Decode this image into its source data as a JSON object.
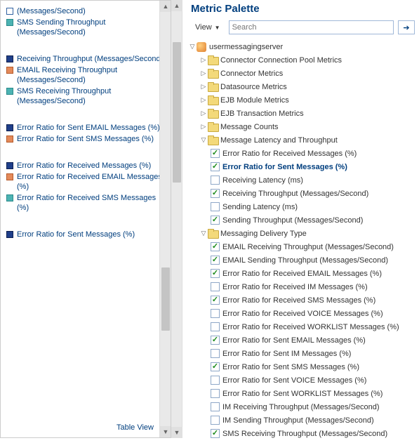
{
  "left_panel": {
    "groups": [
      {
        "items": [
          {
            "color": "#ffffff",
            "border": "#3060a0",
            "label": "(Messages/Second)"
          },
          {
            "color": "#4cb3b3",
            "border": "#2a8a8a",
            "label": "SMS Sending Throughput (Messages/Second)"
          }
        ]
      },
      {
        "items": [
          {
            "color": "#1f3f8a",
            "border": "#0e2050",
            "label": "Receiving Throughput (Messages/Second)"
          },
          {
            "color": "#e48a5a",
            "border": "#b55a2a",
            "label": "EMAIL Receiving Throughput (Messages/Second)"
          },
          {
            "color": "#4cb3b3",
            "border": "#2a8a8a",
            "label": "SMS Receiving Throughput (Messages/Second)"
          }
        ]
      },
      {
        "items": [
          {
            "color": "#1f3f8a",
            "border": "#0e2050",
            "label": "Error Ratio for Sent EMAIL Messages (%)"
          },
          {
            "color": "#e48a5a",
            "border": "#b55a2a",
            "label": "Error Ratio for Sent SMS Messages (%)"
          }
        ]
      },
      {
        "items": [
          {
            "color": "#1f3f8a",
            "border": "#0e2050",
            "label": "Error Ratio for Received Messages (%)"
          },
          {
            "color": "#e48a5a",
            "border": "#b55a2a",
            "label": "Error Ratio for Received EMAIL Messages (%)"
          },
          {
            "color": "#4cb3b3",
            "border": "#2a8a8a",
            "label": "Error Ratio for Received SMS Messages (%)"
          }
        ]
      },
      {
        "items": [
          {
            "color": "#1f3f8a",
            "border": "#0e2050",
            "label": "Error Ratio for Sent Messages (%)"
          }
        ]
      }
    ],
    "table_view": "Table View"
  },
  "right_panel": {
    "title": "Metric Palette",
    "view_label": "View",
    "search_placeholder": "Search",
    "tree": {
      "root": {
        "label": "usermessagingserver",
        "children": [
          {
            "type": "folder",
            "expanded": false,
            "label": "Connector Connection Pool Metrics"
          },
          {
            "type": "folder",
            "expanded": false,
            "label": "Connector Metrics"
          },
          {
            "type": "folder",
            "expanded": false,
            "label": "Datasource Metrics"
          },
          {
            "type": "folder",
            "expanded": false,
            "label": "EJB Module Metrics"
          },
          {
            "type": "folder",
            "expanded": false,
            "label": "EJB Transaction Metrics"
          },
          {
            "type": "folder",
            "expanded": false,
            "label": "Message Counts"
          },
          {
            "type": "folder",
            "expanded": true,
            "label": "Message Latency and Throughput",
            "items": [
              {
                "checked": true,
                "label": "Error Ratio for Received Messages (%)"
              },
              {
                "checked": true,
                "label": "Error Ratio for Sent Messages (%)",
                "selected": true
              },
              {
                "checked": false,
                "label": "Receiving Latency (ms)"
              },
              {
                "checked": true,
                "label": "Receiving Throughput (Messages/Second)"
              },
              {
                "checked": false,
                "label": "Sending Latency (ms)"
              },
              {
                "checked": true,
                "label": "Sending Throughput (Messages/Second)"
              }
            ]
          },
          {
            "type": "folder",
            "expanded": true,
            "label": "Messaging Delivery Type",
            "items": [
              {
                "checked": true,
                "label": "EMAIL Receiving Throughput (Messages/Second)"
              },
              {
                "checked": true,
                "label": "EMAIL Sending Throughput (Messages/Second)"
              },
              {
                "checked": true,
                "label": "Error Ratio for Received EMAIL Messages (%)"
              },
              {
                "checked": false,
                "label": "Error Ratio for Received IM Messages (%)"
              },
              {
                "checked": true,
                "label": "Error Ratio for Received SMS Messages (%)"
              },
              {
                "checked": false,
                "label": "Error Ratio for Received VOICE Messages (%)"
              },
              {
                "checked": false,
                "label": "Error Ratio for Received WORKLIST Messages (%)"
              },
              {
                "checked": true,
                "label": "Error Ratio for Sent EMAIL Messages (%)"
              },
              {
                "checked": false,
                "label": "Error Ratio for Sent IM Messages (%)"
              },
              {
                "checked": true,
                "label": "Error Ratio for Sent SMS Messages (%)"
              },
              {
                "checked": false,
                "label": "Error Ratio for Sent VOICE Messages (%)"
              },
              {
                "checked": false,
                "label": "Error Ratio for Sent WORKLIST Messages (%)"
              },
              {
                "checked": false,
                "label": "IM Receiving Throughput (Messages/Second)"
              },
              {
                "checked": false,
                "label": "IM Sending Throughput (Messages/Second)"
              },
              {
                "checked": true,
                "label": "SMS Receiving Throughput (Messages/Second)"
              }
            ]
          }
        ]
      }
    }
  }
}
